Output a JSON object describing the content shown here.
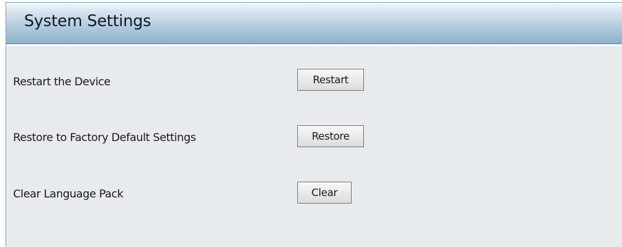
{
  "header": {
    "title": "System Settings"
  },
  "rows": [
    {
      "label": "Restart the Device",
      "button_label": "Restart"
    },
    {
      "label": "Restore to Factory Default Settings",
      "button_label": "Restore"
    },
    {
      "label": "Clear Language Pack",
      "button_label": "Clear"
    }
  ],
  "colors": {
    "header_gradient_top": "#f4f8fb",
    "header_gradient_bottom": "#8fb1cc",
    "panel_background": "#e8ebee",
    "border": "#8aa3bb"
  }
}
